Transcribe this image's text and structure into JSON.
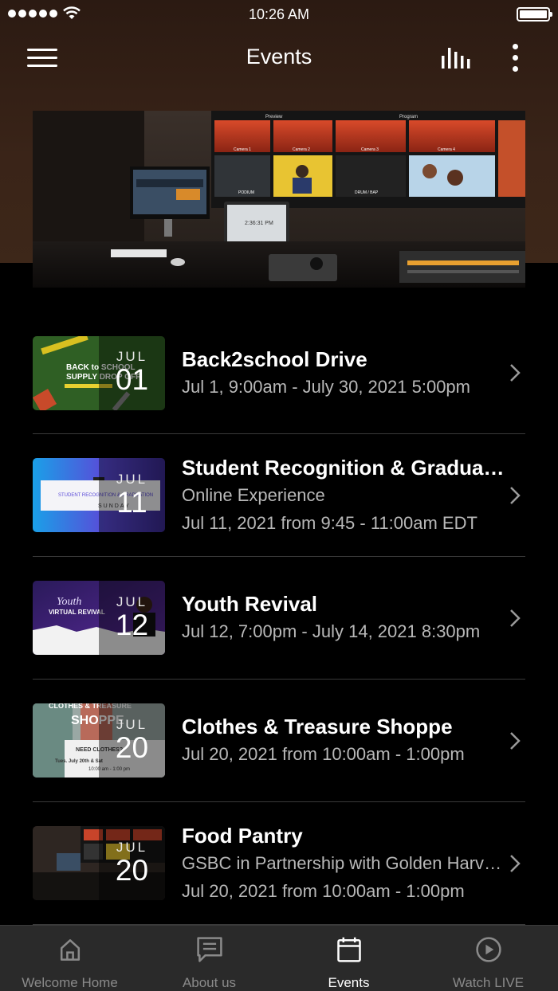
{
  "status_bar": {
    "time": "10:26 AM"
  },
  "nav": {
    "title": "Events"
  },
  "events": [
    {
      "title": "Back2school Drive",
      "lines": [
        "Jul 1, 9:00am - July 30, 2021 5:00pm"
      ],
      "month": "JUL",
      "day": "01"
    },
    {
      "title": "Student Recognition & Graduation",
      "lines": [
        "Online Experience",
        "Jul 11, 2021 from 9:45 - 11:00am EDT"
      ],
      "month": "JUL",
      "day": "11"
    },
    {
      "title": "Youth Revival",
      "lines": [
        "Jul 12, 7:00pm - July 14, 2021 8:30pm"
      ],
      "month": "JUL",
      "day": "12"
    },
    {
      "title": "Clothes & Treasure Shoppe",
      "lines": [
        "Jul 20, 2021 from 10:00am - 1:00pm"
      ],
      "month": "JUL",
      "day": "20"
    },
    {
      "title": "Food Pantry",
      "lines": [
        "GSBC in Partnership with Golden Harvest",
        "Jul 20, 2021 from 10:00am - 1:00pm"
      ],
      "month": "JUL",
      "day": "20"
    }
  ],
  "thumb_text": {
    "back_to_school": "BACK to SCHOOL",
    "supply_drop": "SUPPLY DROP OFF",
    "student_recognition": "STUDENT RECOGNITION & GRADUATION",
    "sunday": "SUNDAY",
    "youth": "Youth",
    "virtual_revival": "VIRTUAL REVIVAL",
    "clothes_treasure": "CLOTHES & TREASURE",
    "shoppe": "SHOPPE",
    "need_clothes": "NEED CLOTHES?",
    "tues_date": "Tues. July 20th & Sat",
    "time_range": "10:00 am - 1:00 pm"
  },
  "hero_text": {
    "preview": "Preview",
    "program": "Program",
    "camera_1": "Camera 1",
    "camera_2": "Camera 2",
    "camera_3": "Camera 3",
    "camera_4": "Camera 4",
    "podium": "PODIUM",
    "drum": "DRUM / BAP",
    "laptop_time": "2:36:31 PM"
  },
  "tabs": [
    {
      "label": "Welcome Home",
      "icon": "home-icon",
      "active": false
    },
    {
      "label": "About us",
      "icon": "message-icon",
      "active": false
    },
    {
      "label": "Events",
      "icon": "calendar-icon",
      "active": true
    },
    {
      "label": "Watch LIVE",
      "icon": "play-circle-icon",
      "active": false
    }
  ]
}
